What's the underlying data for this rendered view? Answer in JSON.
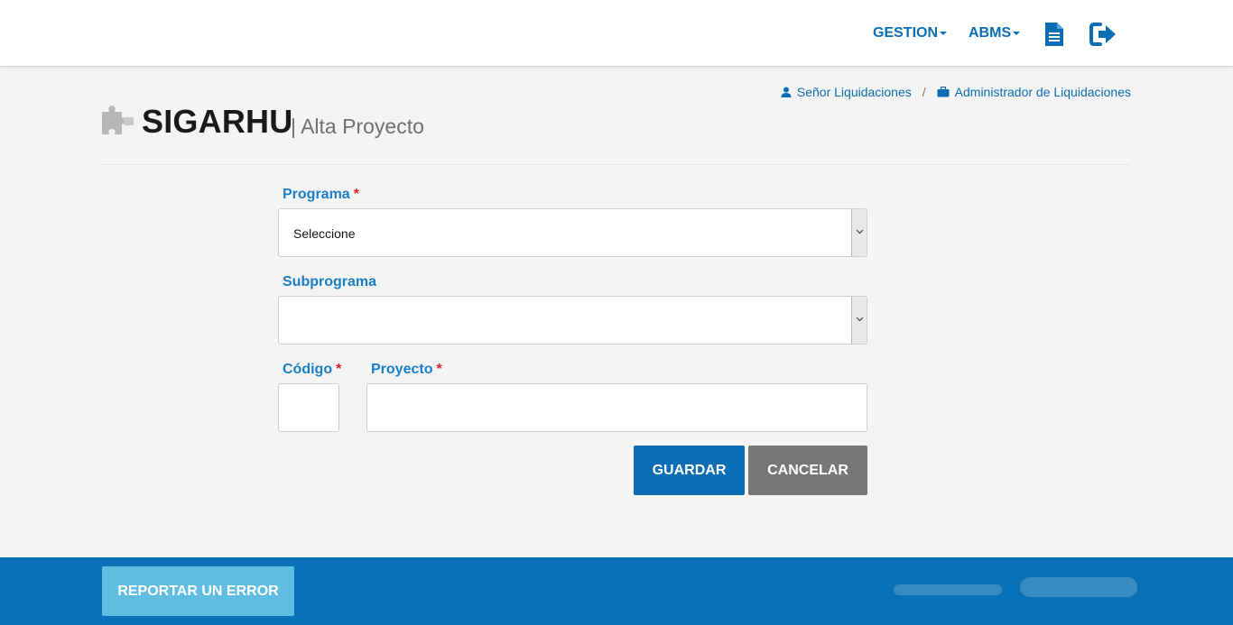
{
  "nav": {
    "gestion_label": "GESTION",
    "abms_label": "ABMS",
    "doc_icon": "document-icon",
    "logout_icon": "sign-out-icon"
  },
  "breadcrumb": {
    "user_label": "Señor Liquidaciones",
    "separator": "/",
    "role_label": "Administrador de Liquidaciones"
  },
  "header": {
    "app_title": "SIGARHU",
    "page_subtitle": "| Alta Proyecto"
  },
  "form": {
    "programa_label": "Programa",
    "programa_required": "*",
    "programa_value": "Seleccione",
    "subprograma_label": "Subprograma",
    "subprograma_value": "",
    "codigo_label": "Código",
    "codigo_required": "*",
    "codigo_value": "",
    "proyecto_label": "Proyecto",
    "proyecto_required": "*",
    "proyecto_value": ""
  },
  "actions": {
    "save_label": "GUARDAR",
    "cancel_label": "CANCELAR"
  },
  "footer": {
    "report_label": "REPORTAR UN ERROR"
  },
  "colors": {
    "primary": "#0a6eb4",
    "label_blue": "#1a7dc6",
    "required_red": "#e0212b",
    "cancel_grey": "#777777",
    "report_light_blue": "#5fbde2"
  }
}
